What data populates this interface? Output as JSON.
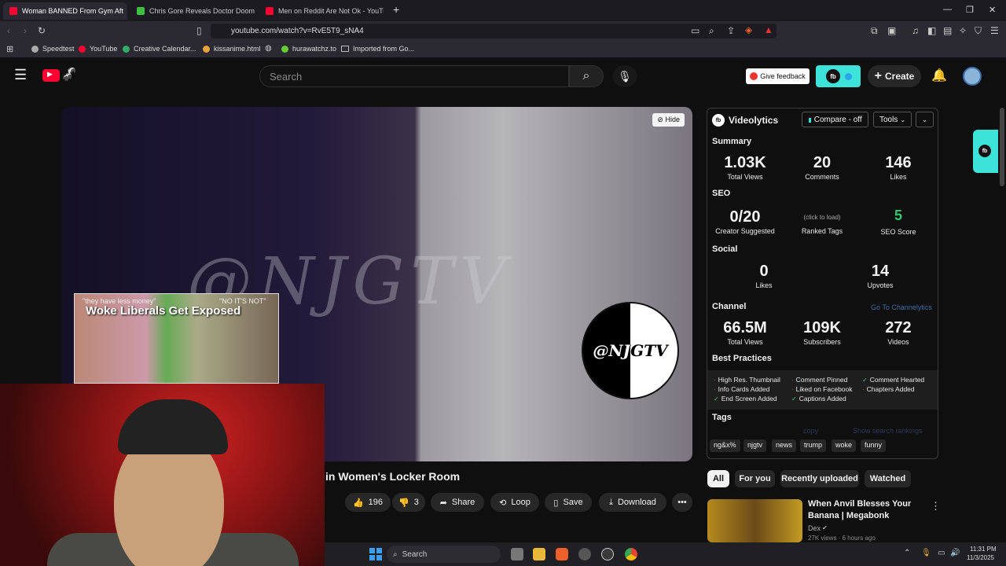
{
  "browser": {
    "tabs": [
      {
        "label": "Woman BANNED From Gym Aft",
        "color": "#ff0033"
      },
      {
        "label": "Chris Gore Reveals Doctor Doom Det",
        "color": "#3fbf3f"
      },
      {
        "label": "Men on Reddit Are Not Ok - YouTub",
        "color": "#ff0033"
      }
    ],
    "url": "youtube.com/watch?v=RvE5T9_sNA4",
    "bookmarks": [
      "Speedtest",
      "YouTube",
      "Creative Calendar...",
      "kissanime.html",
      "hurawatchz.to",
      "Imported from Go..."
    ]
  },
  "youtube": {
    "search_placeholder": "Search",
    "feedback_label": "Give feedback",
    "create_label": "Create",
    "hide_label": "Hide",
    "watermark": "@NJGTV",
    "logo_text": "@NJGTV",
    "thumb_title": "Woke Liberals Get Exposed",
    "thumb_quote1": "\"they have less money\"",
    "thumb_quote2": "\"NO IT'S NOT\"",
    "video_title": "in Women's Locker Room",
    "actions": {
      "likes": "196",
      "dislikes": "3",
      "share": "Share",
      "loop": "Loop",
      "save": "Save",
      "download": "Download"
    },
    "chips": [
      "All",
      "For you",
      "Recently uploaded",
      "Watched"
    ],
    "rec": {
      "title_line1": "When Anvil Blesses Your",
      "title_line2": "Banana | Megabonk",
      "channel": "Dex",
      "meta": "27K views · 6 hours ago"
    }
  },
  "videolytics": {
    "title": "Videolytics",
    "compare": "Compare - off",
    "tools": "Tools",
    "summary": {
      "heading": "Summary",
      "stats": [
        {
          "value": "1.03K",
          "label": "Total Views"
        },
        {
          "value": "20",
          "label": "Comments"
        },
        {
          "value": "146",
          "label": "Likes"
        }
      ]
    },
    "seo": {
      "heading": "SEO",
      "creator_value": "0/20",
      "creator_label": "Creator Suggested",
      "ranked_hint": "(click to load)",
      "ranked_label": "Ranked Tags",
      "score_value": "5",
      "score_label": "SEO Score"
    },
    "social": {
      "heading": "Social",
      "likes_value": "0",
      "likes_label": "Likes",
      "upvotes_value": "14",
      "upvotes_label": "Upvotes"
    },
    "channel": {
      "heading": "Channel",
      "link": "Go To Channelytics",
      "stats": [
        {
          "value": "66.5M",
          "label": "Total Views"
        },
        {
          "value": "109K",
          "label": "Subscribers"
        },
        {
          "value": "272",
          "label": "Videos"
        }
      ]
    },
    "best_practices": {
      "heading": "Best Practices",
      "items": [
        {
          "label": "High Res. Thumbnail",
          "ok": false
        },
        {
          "label": "Comment Pinned",
          "ok": false
        },
        {
          "label": "Comment Hearted",
          "ok": true
        },
        {
          "label": "Info Cards Added",
          "ok": false
        },
        {
          "label": "Liked on Facebook",
          "ok": false
        },
        {
          "label": "Chapters Added",
          "ok": false
        },
        {
          "label": "End Screen Added",
          "ok": true
        },
        {
          "label": "Captions Added",
          "ok": true
        }
      ]
    },
    "tags": {
      "heading": "Tags",
      "copy": "copy",
      "show": "Show search rankings",
      "items": [
        "ng&x%",
        "njgtv",
        "news",
        "trump",
        "woke",
        "funny"
      ]
    }
  },
  "taskbar": {
    "search": "Search",
    "time": "11:31 PM",
    "date": "11/3/2025"
  },
  "colors": {
    "accent": "#3de2d9",
    "youtube_red": "#ff0033",
    "ok_green": "#2ecc71",
    "bad_red": "#e5484d"
  }
}
